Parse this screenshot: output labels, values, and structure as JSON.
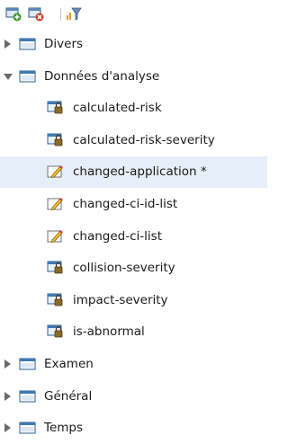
{
  "toolbar": {
    "buttons": [
      {
        "icon": "add-folder-icon"
      },
      {
        "icon": "delete-folder-icon"
      },
      {
        "icon": "filter-icon"
      }
    ]
  },
  "tree": {
    "folders": [
      {
        "label": "Divers",
        "expanded": false,
        "icon": "folder-icon"
      },
      {
        "label": "Données d'analyse",
        "expanded": true,
        "icon": "folder-icon",
        "children": [
          {
            "label": "calculated-risk",
            "icon": "locked-variable-icon"
          },
          {
            "label": "calculated-risk-severity",
            "icon": "locked-variable-icon"
          },
          {
            "label": "changed-application *",
            "icon": "editable-variable-icon",
            "selected": true
          },
          {
            "label": "changed-ci-id-list",
            "icon": "editable-variable-icon"
          },
          {
            "label": "changed-ci-list",
            "icon": "editable-variable-icon"
          },
          {
            "label": "collision-severity",
            "icon": "locked-variable-icon"
          },
          {
            "label": "impact-severity",
            "icon": "locked-variable-icon"
          },
          {
            "label": "is-abnormal",
            "icon": "locked-variable-icon"
          }
        ]
      },
      {
        "label": "Examen",
        "expanded": false,
        "icon": "folder-icon"
      },
      {
        "label": "Général",
        "expanded": false,
        "icon": "folder-icon"
      },
      {
        "label": "Temps",
        "expanded": false,
        "icon": "folder-icon"
      }
    ]
  }
}
